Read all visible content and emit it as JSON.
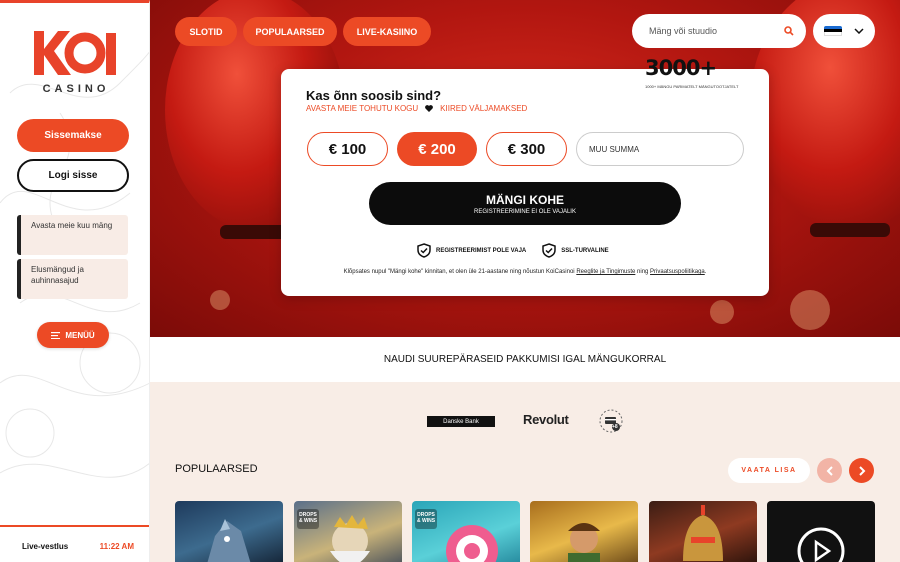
{
  "sidebar": {
    "logo_text": "KOI",
    "logo_sub": "CASINO",
    "deposit_label": "Sissemakse",
    "login_label": "Logi sisse",
    "promos": [
      "Avasta meie kuu mäng",
      "Elusmängud ja auhinnasajud"
    ],
    "menu_label": "MENÜÜ",
    "chat_label": "Live-vestlus",
    "time": "11:22 AM"
  },
  "nav": {
    "tabs": [
      "SLOTID",
      "POPULAARSED",
      "LIVE-KASIINO"
    ],
    "search_placeholder": "Mäng või stuudio",
    "language_flag": [
      "#1a6bd1",
      "#000000",
      "#ffffff"
    ]
  },
  "hero_card": {
    "badge_number": "3000+",
    "badge_sub": "1000+ MÄNGU PARIMATELT MÄNGUTOOTJATELT",
    "title": "Kas õnn soosib sind?",
    "subtitle_left": "AVASTA MEIE TOHUTU KOGU",
    "subtitle_right": "KIIRED VÄLJAMAKSED",
    "amounts": [
      "€ 100",
      "€ 200",
      "€ 300"
    ],
    "selected_amount": "€ 200",
    "custom_amount_placeholder": "MUU SUMMA",
    "play_label": "MÄNGI KOHE",
    "play_sub": "REGISTREERIMINE EI OLE VAJALIK",
    "check1": "REGISTREERIMIST POLE VAJA",
    "check2": "SSL-TURVALINE",
    "terms_prefix": "Klõpsates nupul \"Mängi kohe\" kinnitan, et olen üle 21-aastane ning nõustun KoiCasinoi",
    "terms_link1": "Reeglite ja Tingimuste",
    "terms_mid": "ning",
    "terms_link2": "Privaatsuspoliitikaga",
    "terms_end": "."
  },
  "strip_text": "NAUDI SUUREPÄRASEID PAKKUMISI IGAL MÄNGUKORRAL",
  "payments": {
    "danske": "Danske Bank",
    "revolut": "Revolut",
    "more": "+8"
  },
  "popular": {
    "title": "POPULAARSED",
    "see_all": "VAATA LISA",
    "badge_text": "DROPS & WINS"
  },
  "colors": {
    "accent": "#ec4a25",
    "dark": "#0c0c0c",
    "cream": "#f8ede6"
  }
}
